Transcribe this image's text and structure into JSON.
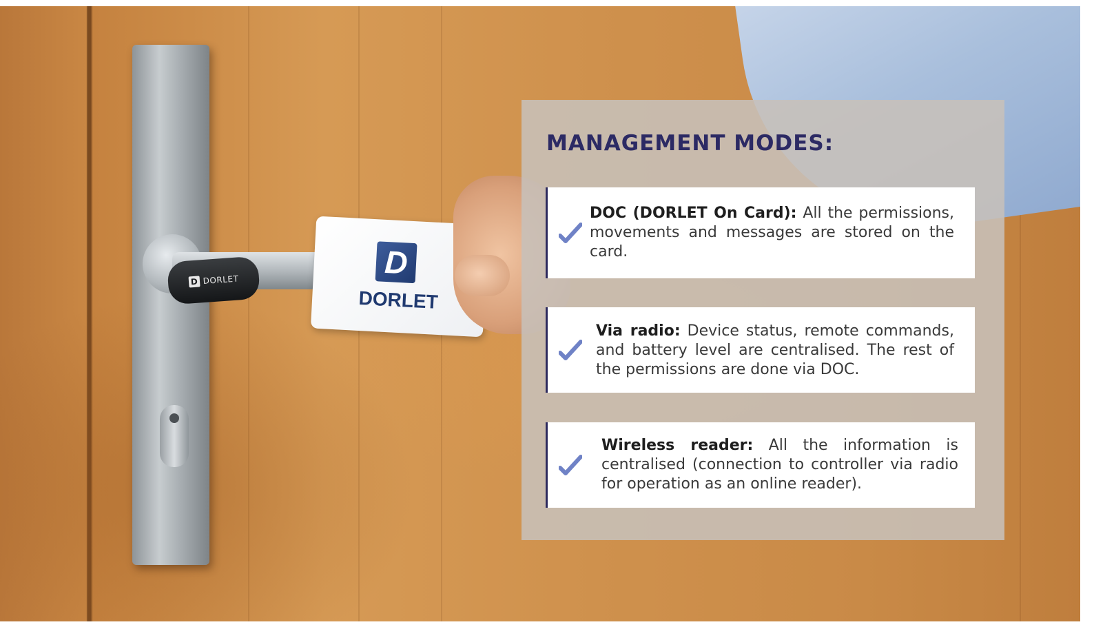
{
  "photo": {
    "reader_logo_text": "DORLET",
    "card_logo_text": "DORLET"
  },
  "panel": {
    "title": "MANAGEMENT MODES:",
    "modes": [
      {
        "icon": "check-icon",
        "name": "DOC (DORLET On Card):",
        "text": "All the permissions, movements and messages are stored on the card."
      },
      {
        "icon": "check-icon",
        "name": "Via radio:",
        "text": "Device status, remote commands, and battery level are centralised. The rest of the permissions are done via DOC."
      },
      {
        "icon": "check-icon",
        "name": "Wireless reader:",
        "text": "All the information is centralised (connection to controller via radio for operation as an online reader)."
      }
    ]
  },
  "colors": {
    "title": "#2c2a64",
    "accent_border": "#2d2a5e",
    "check": "#6f82c6"
  }
}
